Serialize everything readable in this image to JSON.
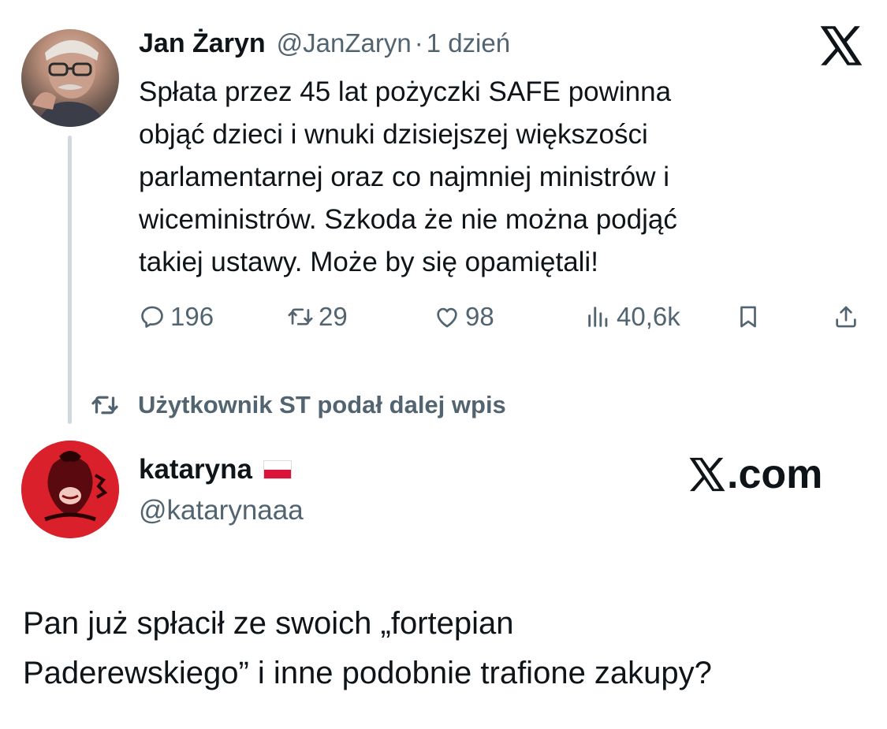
{
  "tweet1": {
    "name": "Jan Żaryn",
    "handle": "@JanZaryn",
    "separator": "·",
    "time": "1 dzień",
    "lines": [
      "Spłata przez 45 lat pożyczki SAFE powinna",
      "objąć dzieci i wnuki dzisiejszej większości",
      "parlamentarnej oraz co najmniej ministrów i",
      "wiceministrów. Szkoda że nie można podjąć",
      "takiej ustawy. Może by się opamiętali!"
    ],
    "stats": {
      "replies": "196",
      "retweets": "29",
      "likes": "98",
      "views": "40,6k"
    }
  },
  "retweet_notice": "Użytkownik ST podał dalej wpis",
  "tweet2": {
    "name": "kataryna",
    "handle": "@katarynaaa",
    "brand": ".com",
    "lines": [
      "Pan już spłacił ze swoich „fortepian",
      "Paderewskiego” i inne podobnie trafione zakupy?"
    ]
  },
  "icons": {
    "x_logo": "x-logo-icon",
    "reply": "reply-icon",
    "retweet": "retweet-icon",
    "like": "heart-icon",
    "views": "views-chart-icon",
    "bookmark": "bookmark-icon",
    "share": "share-icon",
    "flag": "poland-flag-icon"
  },
  "colors": {
    "text": "#0f1419",
    "secondary": "#536471",
    "thread_line": "#cfd9de",
    "avatar2_bg": "#d9202b"
  }
}
